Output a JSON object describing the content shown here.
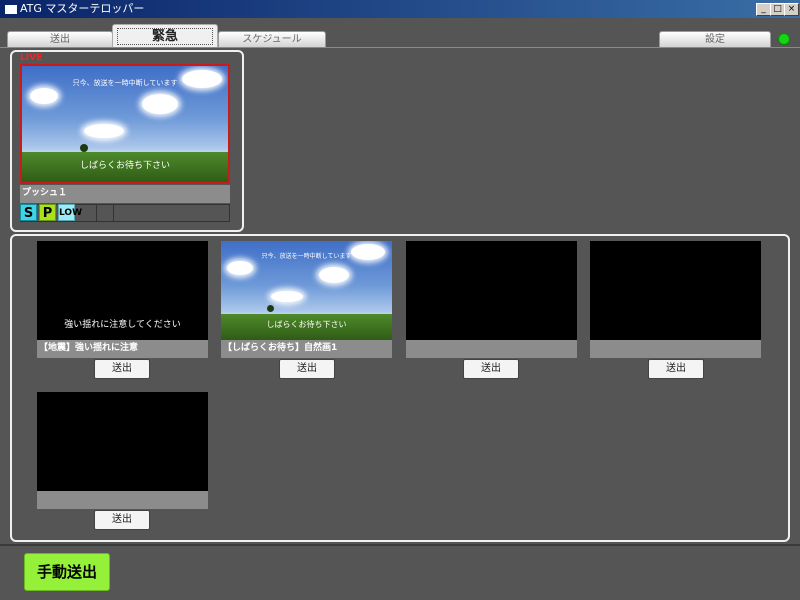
{
  "window": {
    "title": "ATG マスターテロッパー",
    "minimize_glyph": "_",
    "maximize_glyph": "□",
    "close_glyph": "×"
  },
  "tabs": [
    {
      "label": "送出",
      "active": false
    },
    {
      "label": "緊急",
      "active": true
    },
    {
      "label": "スケジュール",
      "active": false
    }
  ],
  "settings_label": "設定",
  "status_color": "#15d615",
  "live": {
    "label": "LIVE",
    "label_color": "#ff2020",
    "top_text": "只今、放送を一時中断しています",
    "bottom_text": "しばらくお待ち下さい",
    "push_label": "プッシュ１",
    "badges": [
      "S",
      "P",
      "LOW"
    ]
  },
  "cards": [
    {
      "name": "【地震】強い揺れに注意",
      "preview": "black",
      "overlay": "強い揺れに注意してください",
      "top_text": "",
      "button": "送出"
    },
    {
      "name": "【しばらくお待ち】自然画1",
      "preview": "landscape",
      "overlay": "しばらくお待ち下さい",
      "top_text": "只今、放送を一時中断しています",
      "button": "送出"
    },
    {
      "name": "",
      "preview": "black",
      "overlay": "",
      "top_text": "",
      "button": "送出"
    },
    {
      "name": "",
      "preview": "black",
      "overlay": "",
      "top_text": "",
      "button": "送出"
    },
    {
      "name": "",
      "preview": "black",
      "overlay": "",
      "top_text": "",
      "button": "送出"
    }
  ],
  "manual_send_label": "手動送出"
}
